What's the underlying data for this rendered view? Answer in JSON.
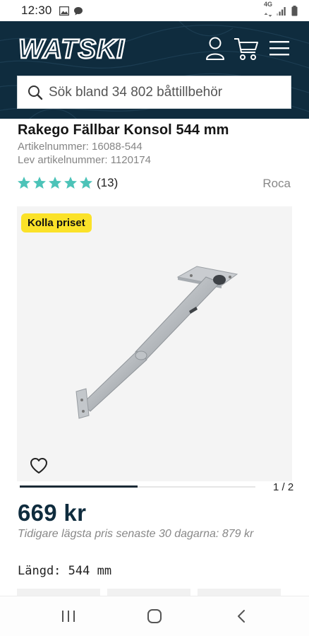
{
  "status_bar": {
    "time": "12:30",
    "network": "4G",
    "icons": [
      "image-icon",
      "chat-bubble-icon",
      "signal-icon",
      "battery-icon"
    ]
  },
  "header": {
    "logo_text": "WATSKI",
    "icons": [
      "account-icon",
      "cart-icon",
      "menu-icon"
    ],
    "search_placeholder": "Sök bland 34 802 båttillbehör"
  },
  "product": {
    "title": "Rakego Fällbar Konsol 544 mm",
    "article_number": "Artikelnummer: 16088-544",
    "supplier_article_number": "Lev artikelnummer: 1120174",
    "rating": {
      "stars": 5,
      "count": "(13)"
    },
    "brand": "Roca",
    "badge": "Kolla priset",
    "gallery": {
      "counter": "1 / 2",
      "progress": 0.5
    },
    "price": "669 kr",
    "previous_price": "Tidigare lägsta pris senaste 30 dagarna: 879 kr",
    "variant": "Längd: 544 mm"
  },
  "colors": {
    "header_bg": "#0f2c3e",
    "star": "#4cc3b8",
    "badge_bg": "#fbe229",
    "price": "#0f2c3e"
  }
}
